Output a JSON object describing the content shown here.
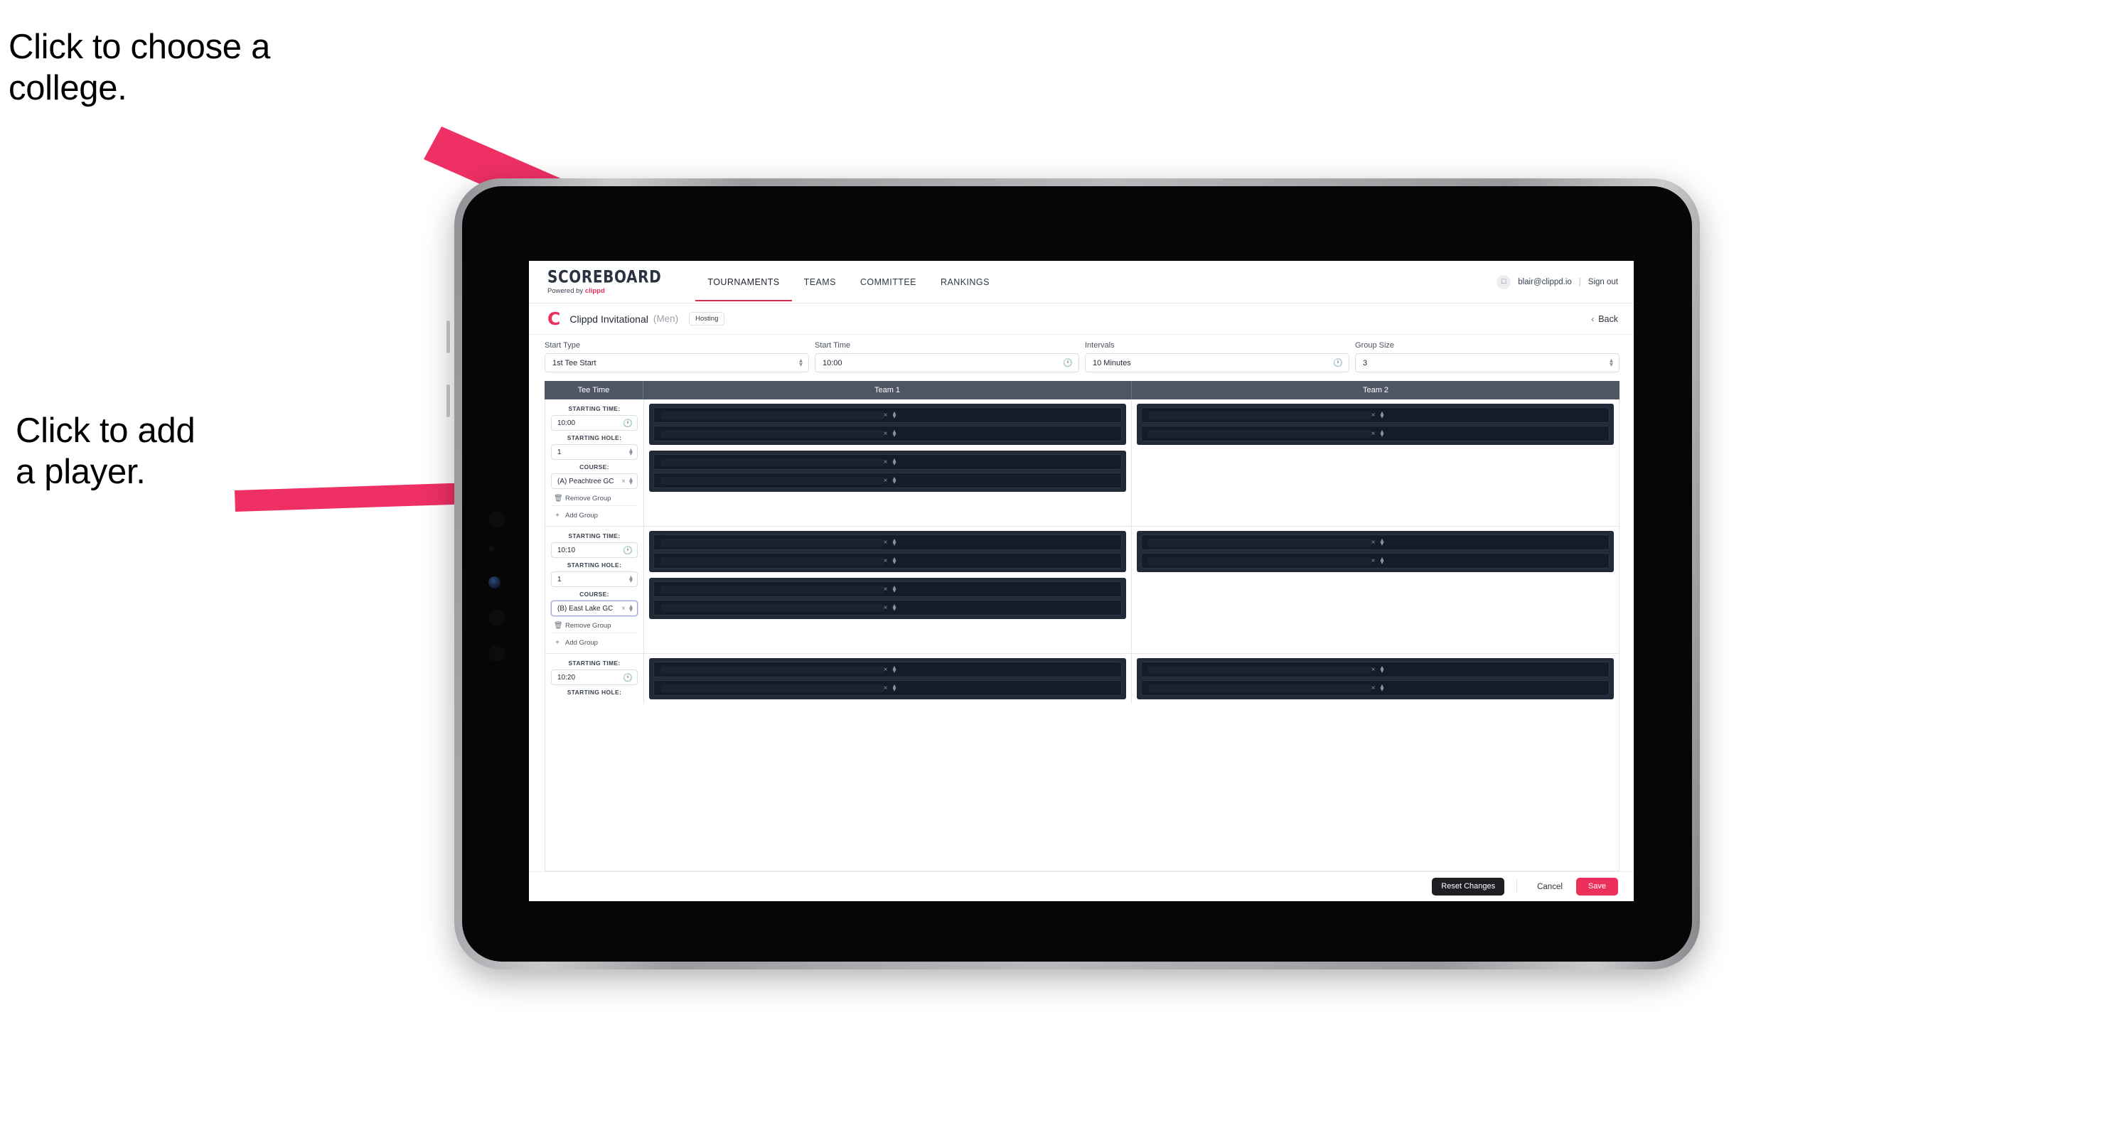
{
  "annotations": {
    "choose_college": "Click to choose a\ncollege.",
    "add_player": "Click to add\na player."
  },
  "colors": {
    "accent_pink": "#ed2f5b",
    "arrow_pink": "#ef3064",
    "nav_active_underline": "#cf2b4d",
    "table_header_bg": "#4e5666",
    "player_block_bg": "#222a38",
    "player_row_bg": "#151c28",
    "reset_button_bg": "#1d1f23"
  },
  "app": {
    "topnav": {
      "logo_word": "SCOREBOARD",
      "logo_sub_prefix": "Powered by ",
      "logo_sub_brand": "clippd",
      "tabs": [
        {
          "label": "TOURNAMENTS",
          "active": true
        },
        {
          "label": "TEAMS",
          "active": false
        },
        {
          "label": "COMMITTEE",
          "active": false
        },
        {
          "label": "RANKINGS",
          "active": false
        }
      ],
      "avatar_icon": "user-avatar-icon",
      "user_email": "blair@clippd.io",
      "separator": "|",
      "sign_out": "Sign out"
    },
    "titlebar": {
      "brand_mark": "C",
      "tournament_name": "Clippd Invitational",
      "gender": "(Men)",
      "hosting_badge": "Hosting",
      "back_chevron": "‹",
      "back_label": "Back"
    },
    "settings": {
      "fields": [
        {
          "label": "Start Type",
          "value": "1st Tee Start",
          "control_icon": "updown-stepper-icon"
        },
        {
          "label": "Start Time",
          "value": "10:00",
          "control_icon": "clock-icon"
        },
        {
          "label": "Intervals",
          "value": "10 Minutes",
          "control_icon": "clock-icon"
        },
        {
          "label": "Group Size",
          "value": "3",
          "control_icon": "updown-stepper-icon"
        }
      ]
    },
    "table": {
      "headers": [
        "Tee Time",
        "Team 1",
        "Team 2"
      ],
      "labels": {
        "starting_time": "STARTING TIME:",
        "starting_hole": "STARTING HOLE:",
        "course": "COURSE:",
        "remove_group": "Remove Group",
        "add_group": "Add Group",
        "trash_icon": "trash-icon",
        "plus_icon": "plus-icon",
        "clock_icon": "clock-icon",
        "clear_icon": "×",
        "stepper_icon": "updown-stepper-icon"
      },
      "rows": [
        {
          "starting_time": "10:00",
          "starting_hole": "1",
          "course": "(A) Peachtree GC",
          "course_focused": false,
          "team1_groups": [
            {
              "players": [
                "",
                ""
              ]
            },
            {
              "players": [
                "",
                ""
              ]
            }
          ],
          "team2_groups": [
            {
              "players": [
                "",
                ""
              ]
            }
          ]
        },
        {
          "starting_time": "10:10",
          "starting_hole": "1",
          "course": "(B) East Lake GC",
          "course_focused": true,
          "team1_groups": [
            {
              "players": [
                "",
                ""
              ]
            },
            {
              "players": [
                "",
                ""
              ]
            }
          ],
          "team2_groups": [
            {
              "players": [
                "",
                ""
              ]
            }
          ]
        },
        {
          "starting_time": "10:20",
          "starting_hole": "",
          "course": "",
          "course_focused": false,
          "team1_groups": [
            {
              "players": [
                "",
                ""
              ]
            }
          ],
          "team2_groups": [
            {
              "players": [
                "",
                ""
              ]
            }
          ]
        }
      ]
    },
    "footer": {
      "reset_label": "Reset Changes",
      "cancel_label": "Cancel",
      "save_label": "Save"
    }
  }
}
